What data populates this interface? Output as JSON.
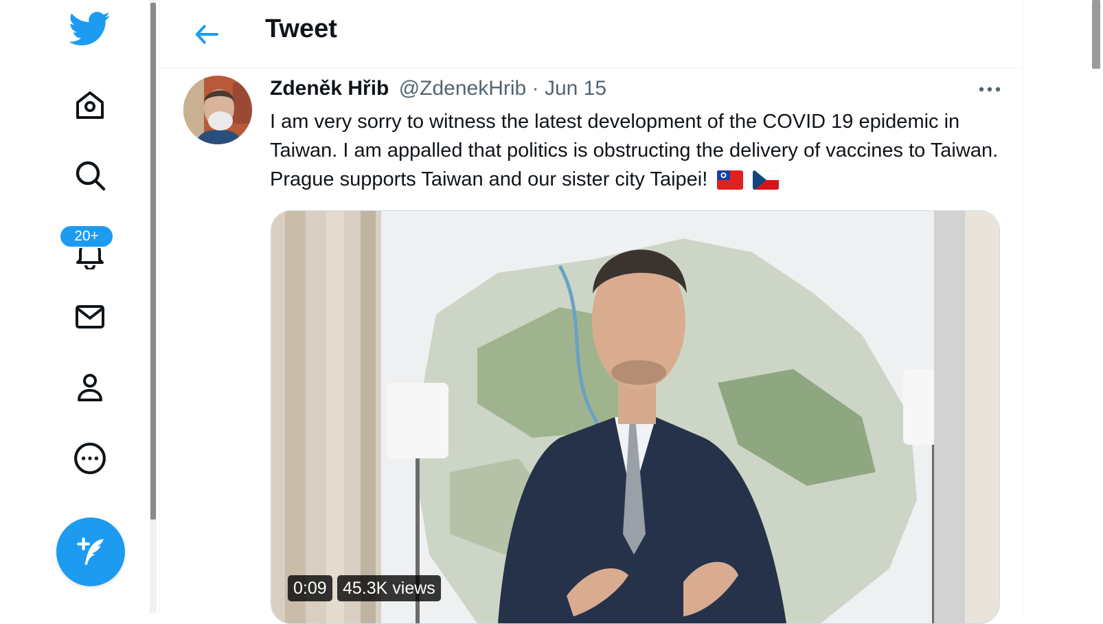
{
  "nav": {
    "items": [
      {
        "name": "twitter-logo-icon"
      },
      {
        "name": "home-icon"
      },
      {
        "name": "explore-search-icon"
      },
      {
        "name": "notifications-bell-icon"
      },
      {
        "name": "messages-mail-icon"
      },
      {
        "name": "profile-person-icon"
      },
      {
        "name": "more-circle-icon"
      }
    ],
    "notifications_badge": "20+",
    "accent_color": "#1d9bf0"
  },
  "header": {
    "title": "Tweet"
  },
  "tweet": {
    "display_name": "Zdeněk Hřib",
    "handle": "@ZdenekHrib",
    "separator": "·",
    "date": "Jun 15",
    "text": "I am very sorry to witness the latest development of the COVID 19 epidemic in Taiwan. I am appalled that politics is obstructing the delivery of vaccines to Taiwan. Prague supports Taiwan and our sister city Taipei!",
    "emojis": [
      "taiwan-flag-icon",
      "czech-flag-icon"
    ],
    "media": {
      "type": "video",
      "duration": "0:09",
      "views": "45.3K views"
    }
  }
}
